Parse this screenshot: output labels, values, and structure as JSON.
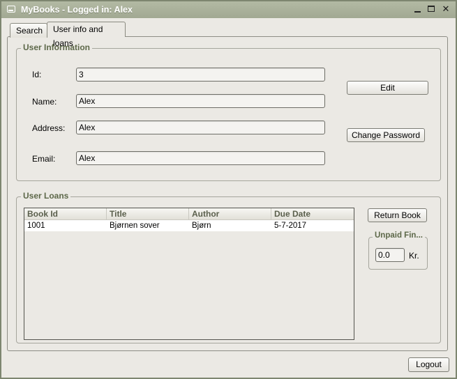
{
  "window": {
    "title": "MyBooks - Logged in: Alex",
    "close_glyph": "✕"
  },
  "tabs": [
    {
      "label": "Search"
    },
    {
      "label": "User info and loans"
    }
  ],
  "user_info": {
    "group_title": "User Information",
    "id_label": "Id:",
    "id_value": "3",
    "name_label": "Name:",
    "name_value": "Alex",
    "address_label": "Address:",
    "address_value": "Alex",
    "email_label": "Email:",
    "email_value": "Alex",
    "edit_button": "Edit",
    "change_password_button": "Change Password"
  },
  "user_loans": {
    "group_title": "User Loans",
    "columns": [
      "Book Id",
      "Title",
      "Author",
      "Due Date"
    ],
    "rows": [
      {
        "book_id": "1001",
        "title": "Bjørnen sover",
        "author": "Bjørn",
        "due_date": "5-7-2017"
      }
    ],
    "return_book_button": "Return Book",
    "unpaid_fines_title": "Unpaid Fin...",
    "unpaid_fines_value": "0.0",
    "currency_label": "Kr."
  },
  "logout_button": "Logout"
}
